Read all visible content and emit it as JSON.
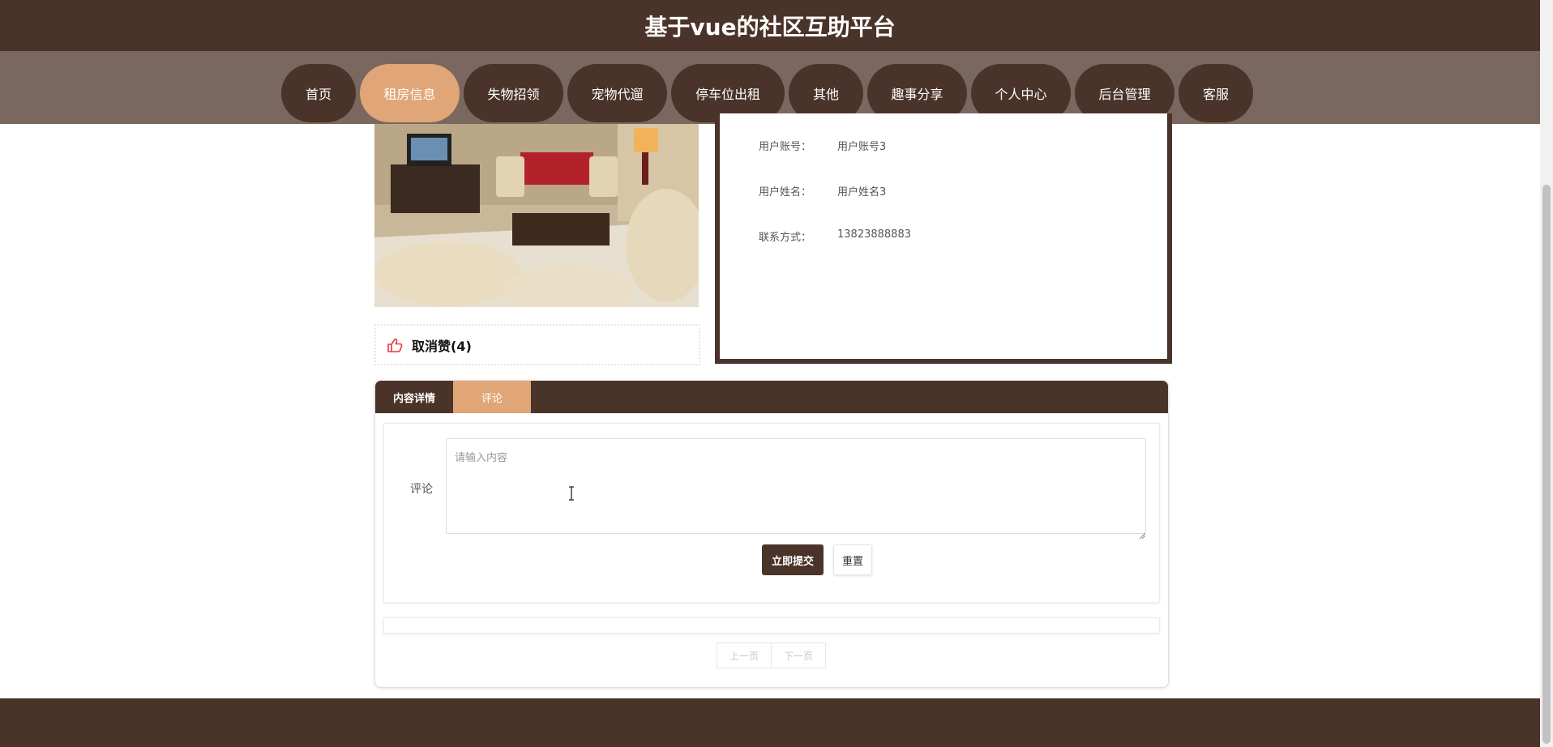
{
  "site_title": "基于vue的社区互助平台",
  "nav": {
    "items": [
      {
        "label": "首页",
        "active": false
      },
      {
        "label": "租房信息",
        "active": true
      },
      {
        "label": "失物招领",
        "active": false
      },
      {
        "label": "宠物代遛",
        "active": false
      },
      {
        "label": "停车位出租",
        "active": false
      },
      {
        "label": "其他",
        "active": false
      },
      {
        "label": "趣事分享",
        "active": false
      },
      {
        "label": "个人中心",
        "active": false
      },
      {
        "label": "后台管理",
        "active": false
      },
      {
        "label": "客服",
        "active": false
      }
    ]
  },
  "detail": {
    "like_label": "取消赞(4)",
    "fields": [
      {
        "key": "用户账号：",
        "value": "用户账号3"
      },
      {
        "key": "用户姓名：",
        "value": "用户姓名3"
      },
      {
        "key": "联系方式：",
        "value": "13823888883"
      }
    ]
  },
  "tabs": {
    "content_detail": "内容详情",
    "comment": "评论"
  },
  "comment_form": {
    "label": "评论",
    "placeholder": "请输入内容",
    "value": "",
    "submit_label": "立即提交",
    "reset_label": "重置"
  },
  "pager": {
    "prev_label": "上一页",
    "next_label": "下一页"
  },
  "colors": {
    "brand_dark": "#4a3329",
    "accent": "#e0a677",
    "nav_bg": "#7a675f"
  },
  "icons": [
    "thumbs-up-icon",
    "resize-grip-icon",
    "text-cursor-icon"
  ]
}
